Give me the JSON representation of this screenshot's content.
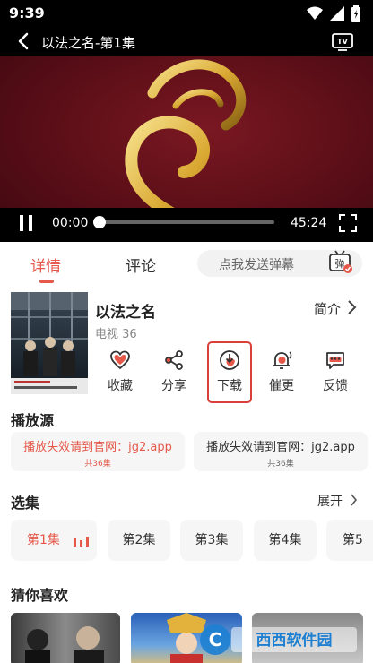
{
  "status": {
    "time": "9:39"
  },
  "player": {
    "title": "以法之名-第1集",
    "current_time": "00:00",
    "duration": "45:24",
    "progress": 0
  },
  "tabs": {
    "active": "详情",
    "inactive": "评论"
  },
  "danmaku": {
    "placeholder": "点我发送弹幕",
    "icon_text": "弹"
  },
  "show": {
    "title": "以法之名",
    "subtitle": "电视 36",
    "intro_label": "简介"
  },
  "actions": [
    {
      "label": "收藏",
      "icon": "heart-icon"
    },
    {
      "label": "分享",
      "icon": "share-icon"
    },
    {
      "label": "下载",
      "icon": "download-icon"
    },
    {
      "label": "催更",
      "icon": "bell-icon"
    },
    {
      "label": "反馈",
      "icon": "feedback-icon"
    }
  ],
  "sources": {
    "heading": "播放源",
    "items": [
      {
        "text": "播放失效请到官网：jg2.app",
        "count": "共36集"
      },
      {
        "text": "播放失效请到官网：jg2.app",
        "count": "共36集"
      }
    ]
  },
  "episodes": {
    "heading": "选集",
    "expand_label": "展开",
    "items": [
      "第1集",
      "第2集",
      "第3集",
      "第4集",
      "第5"
    ]
  },
  "recommend": {
    "heading": "猜你喜欢"
  },
  "colors": {
    "accent": "#e5584a",
    "player_bg": "#5a0e17",
    "highlight_box": "#d9403a"
  }
}
